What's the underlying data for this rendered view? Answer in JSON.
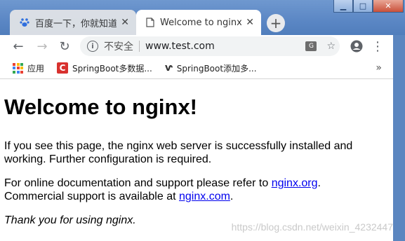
{
  "window": {
    "controls": [
      "minimize",
      "maximize",
      "close"
    ]
  },
  "tabs": [
    {
      "title": "百度一下，你就知道",
      "icon": "baidu-paw-icon",
      "active": false
    },
    {
      "title": "Welcome to nginx!",
      "icon": "page-icon",
      "active": true
    }
  ],
  "toolbar": {
    "security_label": "不安全",
    "url": "www.test.com"
  },
  "bookmarks": [
    {
      "label": "应用",
      "icon": "apps-grid-icon"
    },
    {
      "label": "SpringBoot多数据...",
      "icon": "csdn-c-icon"
    },
    {
      "label": "SpringBoot添加多...",
      "icon": "v-logo-icon"
    }
  ],
  "page": {
    "heading": "Welcome to nginx!",
    "p1": "If you see this page, the nginx web server is successfully installed and working. Further configuration is required.",
    "p2_a": "For online documentation and support please refer to ",
    "p2_link1": "nginx.org",
    "p2_b": ".",
    "p2_c": "Commercial support is available at ",
    "p2_link2": "nginx.com",
    "p2_d": ".",
    "p3": "Thank you for using nginx."
  },
  "watermark": "https://blog.csdn.net/weixin_4232447",
  "colors": {
    "chrome_blue": "#4f7dbb",
    "link": "#0000ee",
    "csdn_red": "#d8312e"
  }
}
